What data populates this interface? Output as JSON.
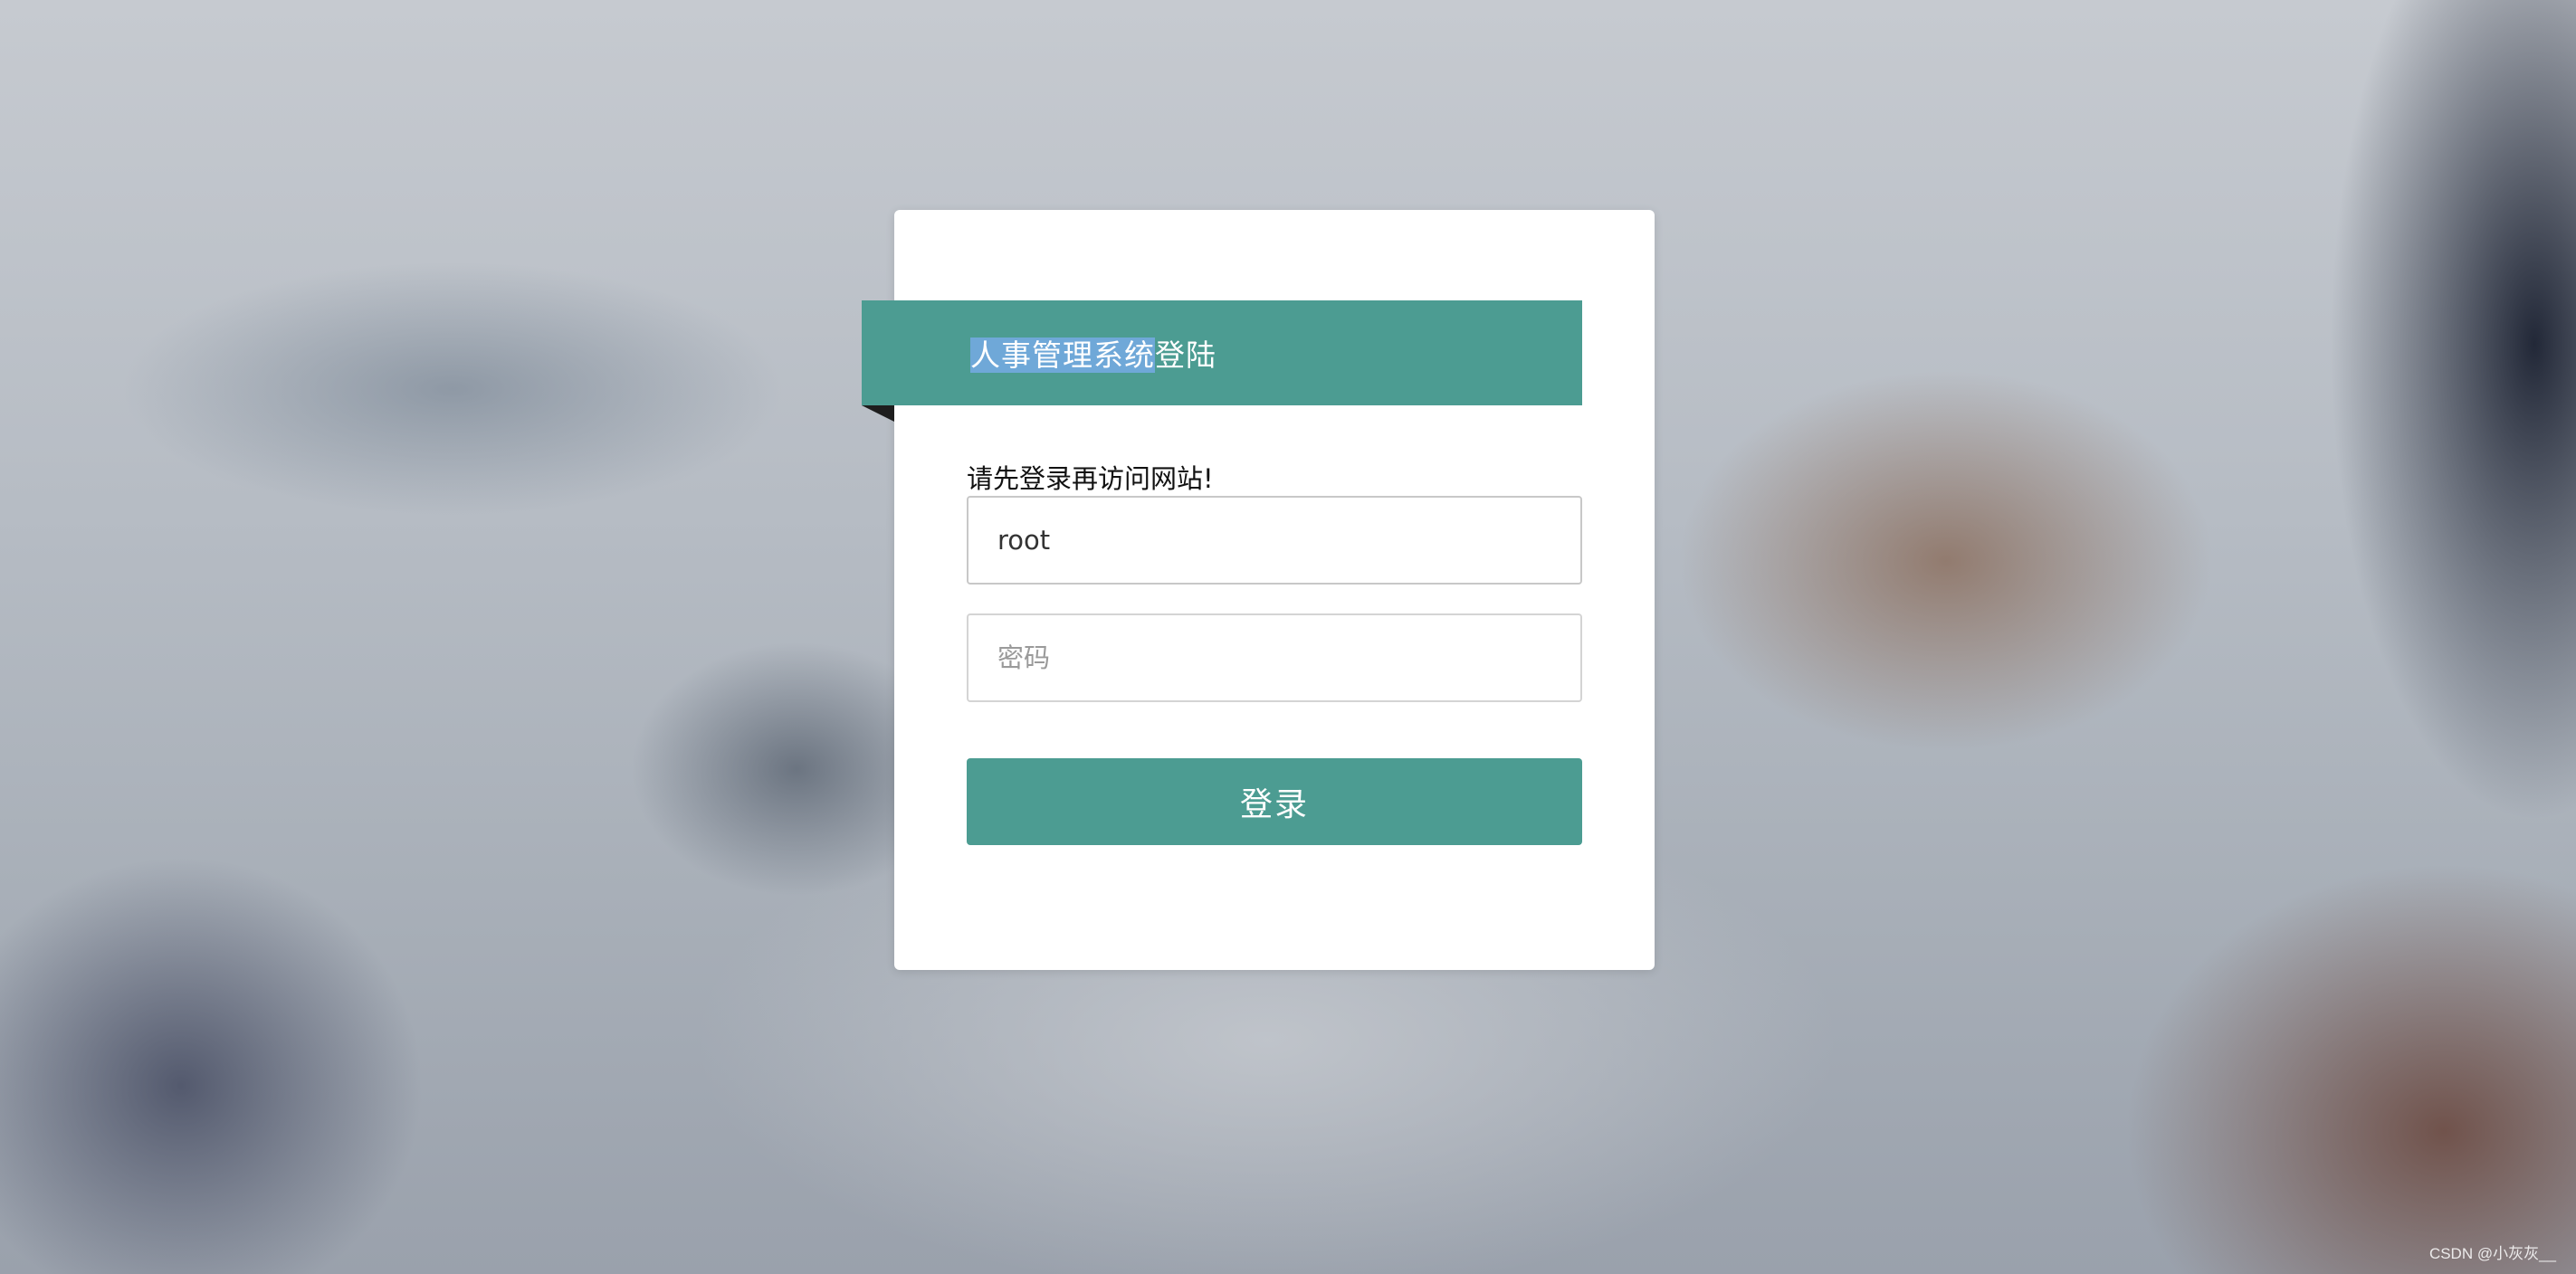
{
  "login": {
    "title_selected": "人事管理系统",
    "title_rest": "登陆",
    "hint": "请先登录再访问网站!",
    "username_value": "root",
    "password_placeholder": "密码",
    "submit_label": "登录"
  },
  "watermark": "CSDN @小灰灰__",
  "colors": {
    "accent": "#4c9c92",
    "selection": "#6fa8d8",
    "card": "#ffffff"
  }
}
